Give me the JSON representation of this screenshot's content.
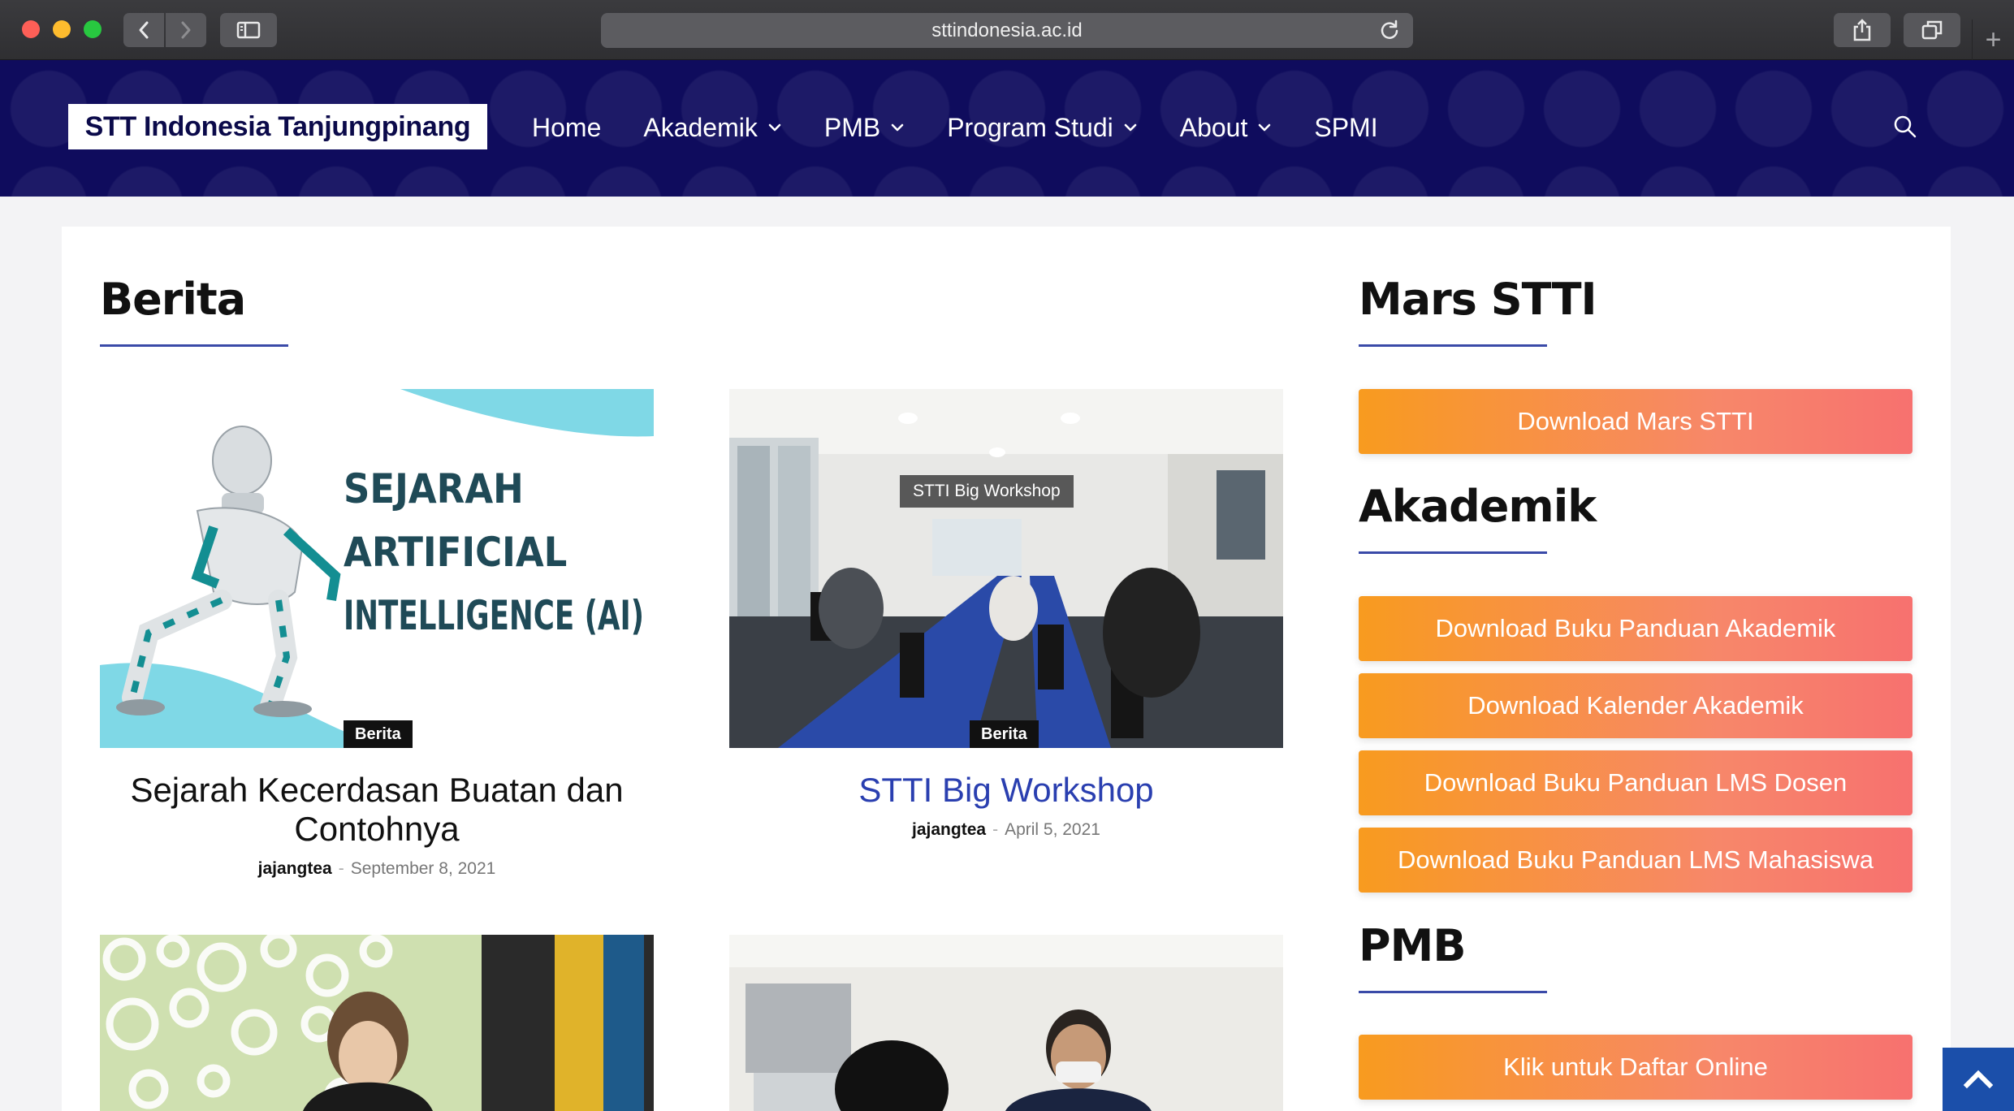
{
  "browser": {
    "url": "sttindonesia.ac.id"
  },
  "site": {
    "logo_text": "STT Indonesia Tanjungpinang",
    "nav": [
      {
        "label": "Home"
      },
      {
        "label": "Akademik"
      },
      {
        "label": "PMB"
      },
      {
        "label": "Program Studi"
      },
      {
        "label": "About"
      },
      {
        "label": "SPMI"
      }
    ]
  },
  "main": {
    "section_title": "Berita",
    "posts": [
      {
        "title": "Sejarah Kecerdasan Buatan dan Contohnya",
        "category": "Berita",
        "author": "jajangtea",
        "date": "September 8, 2021",
        "image_text": [
          "SEJARAH",
          "ARTIFICIAL",
          "INTELLIGENCE (AI)"
        ]
      },
      {
        "title": "STTI Big Workshop",
        "category": "Berita",
        "author": "jajangtea",
        "date": "April 5, 2021",
        "image_text": [
          "STTI Big Workshop"
        ]
      }
    ],
    "dash": "-"
  },
  "sidebar": {
    "mars": {
      "title": "Mars STTI",
      "buttons": [
        "Download Mars STTI"
      ]
    },
    "akademik": {
      "title": "Akademik",
      "buttons": [
        "Download Buku Panduan Akademik",
        "Download Kalender Akademik",
        "Download Buku Panduan LMS Dosen",
        "Download Buku Panduan LMS Mahasiswa"
      ]
    },
    "pmb": {
      "title": "PMB",
      "buttons": [
        "Klik untuk Daftar Online"
      ]
    }
  },
  "colors": {
    "header_bg": "#0f0c5d",
    "accent_underline": "#3a4aa8",
    "link_blue": "#2a3fb0",
    "button_gradient_start": "#f89b1f",
    "button_gradient_end": "#f7716f",
    "back_to_top": "#1b4faa"
  }
}
